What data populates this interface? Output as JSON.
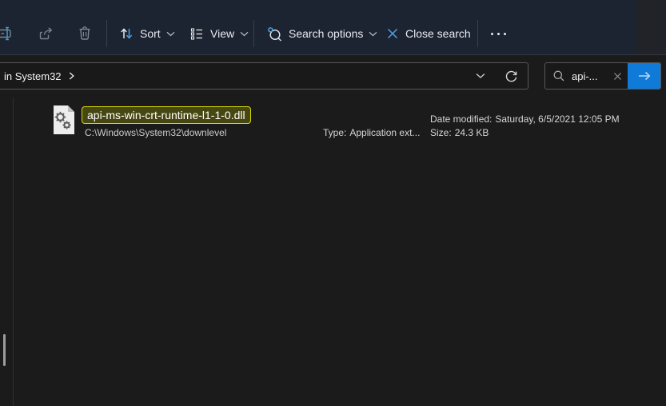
{
  "window": {
    "app": "File Explorer",
    "mode": "search-results",
    "theme": "dark"
  },
  "colors": {
    "toolbar_bg": "#1c2331",
    "content_bg": "#1b1b1b",
    "accent_blue": "#0f7ad7",
    "icon_accent_blue": "#4ba0e0",
    "highlight_border": "#d9d900",
    "highlight_bg": "#474712"
  },
  "toolbar": {
    "sort_label": "Sort",
    "view_label": "View",
    "search_options_label": "Search options",
    "close_search_label": "Close search"
  },
  "address_bar": {
    "breadcrumb": "in System32"
  },
  "search": {
    "value": "api-..."
  },
  "file": {
    "name": "api-ms-win-crt-runtime-l1-1-0.dll",
    "path": "C:\\Windows\\System32\\downlevel",
    "type_label": "Type:",
    "type_value": "Application ext...",
    "date_label": "Date modified:",
    "date_value": "Saturday, 6/5/2021 12:05 PM",
    "size_label": "Size:",
    "size_value": "24.3 KB"
  },
  "icons": {
    "rename": "rename-box-with-cursor",
    "share": "share-arrow-from-box",
    "delete": "trash-can",
    "sort": "up-down-arrows",
    "view": "list-view",
    "search_options": "magnifier-with-gear",
    "close_search": "blue-x",
    "more": "ellipsis-three-dots",
    "address_dropdown": "chevron-down",
    "refresh": "circular-arrow",
    "search": "magnifier",
    "clear_search": "x",
    "go": "arrow-right",
    "file": "dll-document-with-gears"
  }
}
